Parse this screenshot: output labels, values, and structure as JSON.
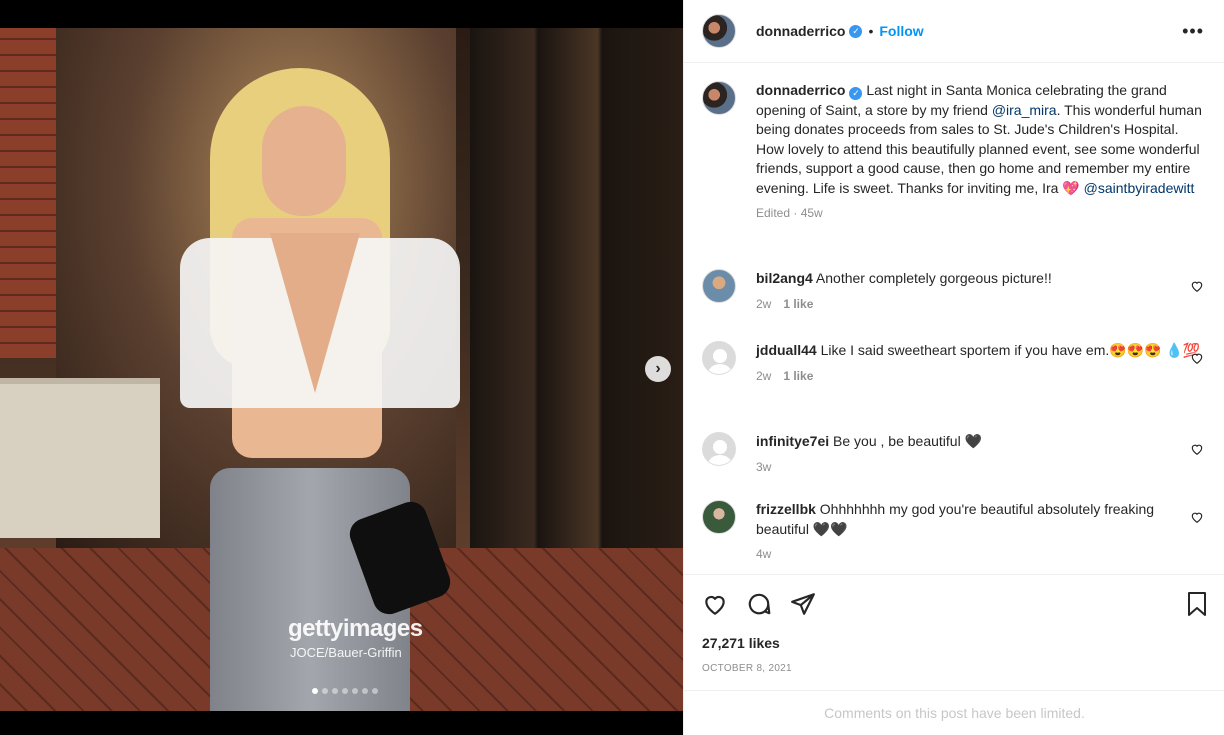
{
  "post": {
    "username": "donnaderrico",
    "follow_label": "Follow",
    "separator": "•",
    "more_label": "•••",
    "caption": {
      "text_1": "Last night in Santa Monica celebrating the grand opening of Saint, a store by my friend ",
      "mention_1": "@ira_mira",
      "text_2": ". This wonderful human being donates proceeds from sales to St. Jude's Children's Hospital. How lovely to attend this beautifully planned event, see some wonderful friends, support a good cause, then go home and remember my entire evening. Life is sweet. Thanks for inviting me, Ira 💖 ",
      "mention_2": "@saintbyiradewitt",
      "meta": "Edited · 45w"
    },
    "likes": "27,271 likes",
    "date": "OCTOBER 8, 2021",
    "comments_limited": "Comments on this post have been limited."
  },
  "media": {
    "watermark": "gettyimages",
    "credit": "JOCE/Bauer-Griffin",
    "next_label": "›",
    "slide_count": 7,
    "active_slide": 1
  },
  "comments": [
    {
      "username": "bil2ang4",
      "text": "Another completely gorgeous picture!!",
      "time": "2w",
      "likes": "1 like"
    },
    {
      "username": "jdduall44",
      "text": "Like I said sweetheart sportem if you have em.😍😍😍 💧💯",
      "time": "2w",
      "likes": "1 like"
    },
    {
      "username": "infinitye7ei",
      "text": "Be you , be beautiful 🖤",
      "time": "3w",
      "likes": ""
    },
    {
      "username": "frizzellbk",
      "text": "Ohhhhhhh my god you're beautiful absolutely freaking beautiful 🖤🖤",
      "time": "4w",
      "likes": ""
    }
  ],
  "icons": {
    "like": "heart-icon",
    "comment": "comment-icon",
    "share": "share-icon",
    "save": "bookmark-icon",
    "verified": "verified-badge-icon",
    "verified_color": "#3897f0",
    "follow_color": "#0095f6"
  }
}
